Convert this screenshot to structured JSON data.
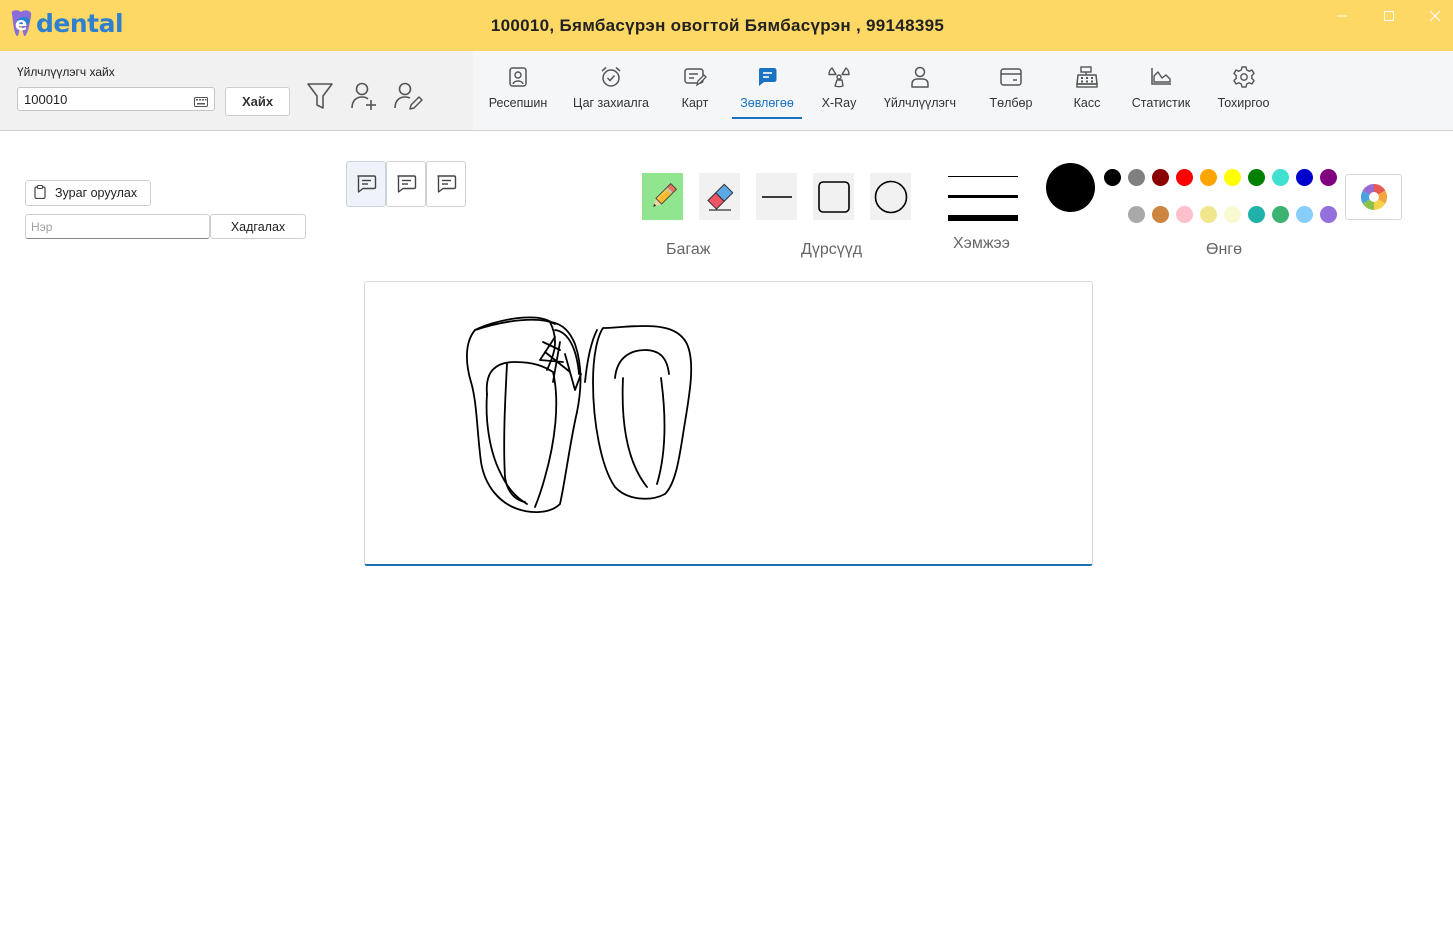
{
  "app": {
    "logo_text": "dental",
    "window_title": "100010, Бямбасүрэн  овогтой Бямбасүрэн , 99148395"
  },
  "window_controls": {
    "minimize_icon": "minimize-icon",
    "maximize_icon": "maximize-icon",
    "close_icon": "close-icon"
  },
  "search": {
    "label": "Үйлчлүүлэгч хайх",
    "value": "100010",
    "button_label": "Хайх"
  },
  "toolbar_icons": [
    "filter-icon",
    "add-user-icon",
    "edit-user-icon"
  ],
  "nav": {
    "items": [
      {
        "label": "Ресепшин",
        "icon": "reception-icon"
      },
      {
        "label": "Цаг захиалга",
        "icon": "alarm-clock-icon"
      },
      {
        "label": "Карт",
        "icon": "card-edit-icon"
      },
      {
        "label": "Зөвлөгөө",
        "icon": "advice-chat-icon"
      },
      {
        "label": "X-Ray",
        "icon": "radiation-icon"
      },
      {
        "label": "Үйлчлүүлэгч",
        "icon": "person-icon"
      },
      {
        "label": "Төлбөр",
        "icon": "payment-card-icon"
      },
      {
        "label": "Касс",
        "icon": "cash-register-icon"
      },
      {
        "label": "Статистик",
        "icon": "chart-icon"
      },
      {
        "label": "Тохиргоо",
        "icon": "gear-icon"
      }
    ],
    "active_index": 3,
    "active_color": "#1a73c2"
  },
  "left_panel": {
    "upload_label": "Зураг оруулах",
    "name_placeholder": "Нэр",
    "name_value": "",
    "save_label": "Хадгалах"
  },
  "note_buttons": [
    "note-1-icon",
    "note-2-icon",
    "note-3-icon"
  ],
  "drawing": {
    "tools_label": "Багаж",
    "shapes_label": "Дүрсүүд",
    "size_label": "Хэмжээ",
    "color_label": "Өнгө",
    "active_tool": "pencil",
    "selected_color": "#000000",
    "palette_row1": [
      "#000000",
      "#808080",
      "#8b0000",
      "#ff0000",
      "#ffa500",
      "#ffff00",
      "#008000",
      "#40e0d0",
      "#0000cd",
      "#800080"
    ],
    "palette_row2": [
      "#a9a9a9",
      "#cd853f",
      "#ffc0cb",
      "#f0e68c",
      "#fafad2",
      "#20b2aa",
      "#3cb371",
      "#87cefa",
      "#9370db"
    ]
  },
  "colors": {
    "titlebar": "#fdd865",
    "accent": "#1a73c2",
    "active_tool_bg": "#90e58e"
  }
}
